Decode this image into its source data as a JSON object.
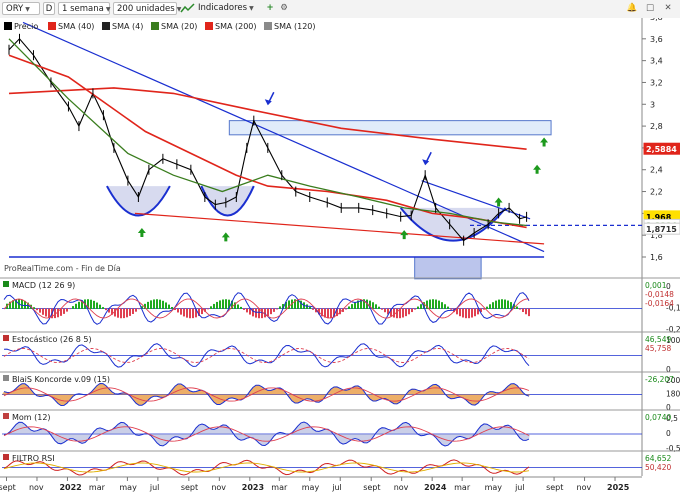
{
  "toolbar": {
    "symbol": "ORY",
    "bar_type_icon": "D",
    "interval": "1 semana",
    "units": "200 unidades",
    "indicators_label": "Indicadores",
    "icon_names": [
      "candlestick-icon",
      "chevron-down-icon",
      "chart-type-icon",
      "indicators-icon",
      "add-icon",
      "settings-icon",
      "alert-icon",
      "maximize-icon",
      "close-icon"
    ]
  },
  "colors": {
    "price": "#000000",
    "sma40": "#e0251b",
    "sma4": "#222222",
    "sma20": "#3a7d1e",
    "sma200": "#e0251b",
    "sma120": "#8a8a8a",
    "trendline": "#1a2fd0",
    "arrow_up": "#1d9a1d",
    "last_price_badge": "#ffe000",
    "sma200_badge": "#e0251b",
    "macd_up": "#1faa1f",
    "macd_down": "#e04050"
  },
  "main_panel": {
    "legend": [
      {
        "label": "Precio",
        "color": "#000000",
        "type": "price"
      },
      {
        "label": "SMA (40)",
        "color": "#e0251b",
        "type": "line"
      },
      {
        "label": "SMA (4)",
        "color": "#222222",
        "type": "line"
      },
      {
        "label": "SMA (20)",
        "color": "#3a7d1e",
        "type": "line"
      },
      {
        "label": "SMA (200)",
        "color": "#e0251b",
        "type": "line"
      },
      {
        "label": "SMA (120)",
        "color": "#8a8a8a",
        "type": "line"
      }
    ],
    "source_note": "ProRealTime.com - Fin de Día",
    "y_ticks": [
      "3,8",
      "3,6",
      "3,4",
      "3,2",
      "3",
      "2,8",
      "2,6",
      "2,4",
      "2,2",
      "2",
      "1,8",
      "1,6"
    ],
    "badges": [
      {
        "text": "2,5884",
        "value": 2.588,
        "bg": "#e0251b",
        "fg": "#ffffff"
      },
      {
        "text": "1,968",
        "value": 1.968,
        "bg": "#ffe000",
        "fg": "#000000"
      },
      {
        "text": "1,8884",
        "value": 1.89,
        "bg": "#ffffff",
        "fg": "#3a7d1e"
      },
      {
        "text": "1,8715",
        "value": 1.855,
        "bg": "#ffffff",
        "fg": "#333333"
      }
    ]
  },
  "indicator_panels": [
    {
      "label": "MACD (12 26 9)",
      "icon": "macd-icon",
      "values": [
        "0,001",
        "-0,0148",
        "-0,0164"
      ],
      "ticks": [
        "0",
        "-0,1",
        "-0,2"
      ]
    },
    {
      "label": "Estocástico (26 8 5)",
      "icon": "stochastic-icon",
      "values": [
        "46,549",
        "45,758"
      ],
      "ticks": [
        "100",
        "0"
      ]
    },
    {
      "label": "BlaiS Koncorde v.09 (15)",
      "icon": "koncorde-icon",
      "values": [
        "-26,207"
      ],
      "ticks": [
        "200",
        "180",
        "0"
      ]
    },
    {
      "label": "Mom (12)",
      "icon": "momentum-icon",
      "values": [
        "0,0740"
      ],
      "ticks": [
        "0,5",
        "0",
        "-0,5"
      ]
    },
    {
      "label": "FILTRO RSI",
      "icon": "rsi-icon",
      "values": [
        "64,652",
        "50,420"
      ],
      "ticks": []
    }
  ],
  "x_axis": {
    "labels": [
      "sept",
      "nov",
      "2022",
      "mar",
      "may",
      "jul",
      "sept",
      "nov",
      "2023",
      "mar",
      "may",
      "jul",
      "sept",
      "nov",
      "2024",
      "mar",
      "may",
      "jul",
      "sept",
      "nov",
      "2025"
    ],
    "bold": [
      "2022",
      "2023",
      "2024",
      "2025"
    ]
  },
  "chart_data": {
    "type": "line",
    "title": "",
    "x_start": "2021-09",
    "x_end": "2025-02",
    "ylim": [
      1.45,
      3.85
    ],
    "series": [
      {
        "name": "Precio",
        "points": [
          [
            "2021-09-06",
            3.5
          ],
          [
            "2021-09-27",
            3.6
          ],
          [
            "2021-10-25",
            3.45
          ],
          [
            "2021-11-29",
            3.2
          ],
          [
            "2022-01-03",
            2.98
          ],
          [
            "2022-01-24",
            2.8
          ],
          [
            "2022-02-21",
            3.1
          ],
          [
            "2022-03-14",
            2.9
          ],
          [
            "2022-04-04",
            2.6
          ],
          [
            "2022-05-02",
            2.3
          ],
          [
            "2022-05-23",
            2.15
          ],
          [
            "2022-06-13",
            2.4
          ],
          [
            "2022-07-11",
            2.5
          ],
          [
            "2022-08-08",
            2.45
          ],
          [
            "2022-09-05",
            2.4
          ],
          [
            "2022-10-03",
            2.15
          ],
          [
            "2022-10-24",
            2.08
          ],
          [
            "2022-11-14",
            2.1
          ],
          [
            "2022-12-05",
            2.15
          ],
          [
            "2022-12-26",
            2.6
          ],
          [
            "2023-01-09",
            2.85
          ],
          [
            "2023-02-06",
            2.6
          ],
          [
            "2023-03-06",
            2.35
          ],
          [
            "2023-04-03",
            2.2
          ],
          [
            "2023-05-01",
            2.15
          ],
          [
            "2023-06-05",
            2.1
          ],
          [
            "2023-07-03",
            2.05
          ],
          [
            "2023-08-07",
            2.05
          ],
          [
            "2023-09-04",
            2.03
          ],
          [
            "2023-10-02",
            2.0
          ],
          [
            "2023-10-30",
            1.97
          ],
          [
            "2023-11-20",
            1.98
          ],
          [
            "2023-12-18",
            2.35
          ],
          [
            "2024-01-08",
            2.05
          ],
          [
            "2024-02-05",
            1.9
          ],
          [
            "2024-03-04",
            1.75
          ],
          [
            "2024-03-25",
            1.82
          ],
          [
            "2024-04-22",
            1.9
          ],
          [
            "2024-05-13",
            2.0
          ],
          [
            "2024-06-03",
            2.05
          ],
          [
            "2024-06-24",
            1.95
          ],
          [
            "2024-07-08",
            1.968
          ]
        ]
      },
      {
        "name": "SMA (200)",
        "points": [
          [
            "2021-09-06",
            3.1
          ],
          [
            "2022-04-04",
            3.15
          ],
          [
            "2022-08-01",
            3.1
          ],
          [
            "2023-01-02",
            2.95
          ],
          [
            "2023-07-03",
            2.78
          ],
          [
            "2024-01-01",
            2.68
          ],
          [
            "2024-07-08",
            2.588
          ]
        ]
      },
      {
        "name": "SMA (40)",
        "points": [
          [
            "2021-09-06",
            3.45
          ],
          [
            "2022-01-03",
            3.25
          ],
          [
            "2022-06-06",
            2.75
          ],
          [
            "2022-12-05",
            2.35
          ],
          [
            "2023-02-06",
            2.25
          ],
          [
            "2023-06-05",
            2.2
          ],
          [
            "2023-10-02",
            2.12
          ],
          [
            "2024-01-01",
            2.0
          ],
          [
            "2024-04-01",
            1.95
          ],
          [
            "2024-07-08",
            1.87
          ]
        ]
      },
      {
        "name": "SMA (20)",
        "points": [
          [
            "2021-09-06",
            3.6
          ],
          [
            "2022-01-03",
            3.05
          ],
          [
            "2022-05-02",
            2.55
          ],
          [
            "2022-08-01",
            2.35
          ],
          [
            "2022-11-07",
            2.2
          ],
          [
            "2023-02-06",
            2.35
          ],
          [
            "2023-05-01",
            2.25
          ],
          [
            "2023-08-07",
            2.15
          ],
          [
            "2023-11-06",
            2.05
          ],
          [
            "2024-02-05",
            2.0
          ],
          [
            "2024-05-06",
            1.92
          ],
          [
            "2024-07-08",
            1.889
          ]
        ]
      }
    ],
    "annotations": [
      {
        "type": "trendline",
        "from": [
          "2021-10-04",
          3.75
        ],
        "to": [
          "2024-08-12",
          1.65
        ]
      },
      {
        "type": "trendline",
        "from": [
          "2021-09-06",
          1.6
        ],
        "to": [
          "2024-08-12",
          1.6
        ]
      },
      {
        "type": "trendline",
        "from": [
          "2022-05-16",
          2.0
        ],
        "to": [
          "2024-08-12",
          1.72
        ]
      },
      {
        "type": "trendline",
        "from": [
          "2023-12-11",
          2.3
        ],
        "to": [
          "2024-07-15",
          1.95
        ]
      },
      {
        "type": "box",
        "from": [
          "2022-11-21",
          2.85
        ],
        "to": [
          "2024-08-26",
          2.72
        ]
      },
      {
        "type": "box",
        "from": [
          "2023-11-27",
          1.6
        ],
        "to": [
          "2024-04-08",
          1.4
        ]
      }
    ]
  }
}
